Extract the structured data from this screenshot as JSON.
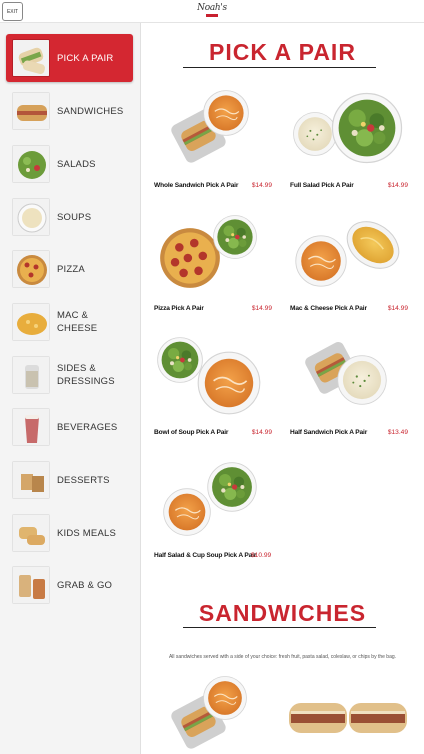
{
  "header": {
    "exit_label": "EXIT",
    "logo_text": "Noah's"
  },
  "sidebar": {
    "items": [
      {
        "label": "PICK A PAIR",
        "thumb": "wrap-sandwich",
        "active": true
      },
      {
        "label": "SANDWICHES",
        "thumb": "sandwich",
        "active": false
      },
      {
        "label": "SALADS",
        "thumb": "salad",
        "active": false
      },
      {
        "label": "SOUPS",
        "thumb": "soup",
        "active": false
      },
      {
        "label": "PIZZA",
        "thumb": "pizza",
        "active": false
      },
      {
        "label": "MAC &\nCHEESE",
        "thumb": "mac-cheese",
        "active": false
      },
      {
        "label": "SIDES &\nDRESSINGS",
        "thumb": "sides",
        "active": false
      },
      {
        "label": "BEVERAGES",
        "thumb": "beverage",
        "active": false
      },
      {
        "label": "DESSERTS",
        "thumb": "dessert",
        "active": false
      },
      {
        "label": "KIDS MEALS",
        "thumb": "kids-meal",
        "active": false
      },
      {
        "label": "GRAB & GO",
        "thumb": "grab-go",
        "active": false
      }
    ]
  },
  "main": {
    "pick_a_pair": {
      "title": "PICK A PAIR",
      "products": [
        {
          "name": "Whole Sandwich Pick A Pair",
          "price": "$14.99",
          "image": "sandwich-and-soup"
        },
        {
          "name": "Full Salad Pick A Pair",
          "price": "$14.99",
          "image": "soup-and-salad"
        },
        {
          "name": "Pizza Pick A Pair",
          "price": "$14.99",
          "image": "pizza-and-salad"
        },
        {
          "name": "Mac & Cheese Pick A Pair",
          "price": "$14.99",
          "image": "soup-and-mac"
        },
        {
          "name": "Bowl of Soup Pick A Pair",
          "price": "$14.99",
          "image": "salad-and-soup"
        },
        {
          "name": "Half Sandwich Pick A Pair",
          "price": "$13.49",
          "image": "half-sandwich-and-soup"
        },
        {
          "name": "Half Salad & Cup Soup Pick A Pair",
          "price": "$10.99",
          "image": "cup-soup-and-salad"
        }
      ]
    },
    "sandwiches": {
      "title": "SANDWICHES",
      "note": "All sandwiches served with a side of your choice: fresh fruit, pasta salad, coleslaw, or chips by the bag."
    }
  },
  "colors": {
    "accent": "#c9252f",
    "active_nav": "#d42731",
    "sidebar_bg": "#f4f4f4"
  }
}
